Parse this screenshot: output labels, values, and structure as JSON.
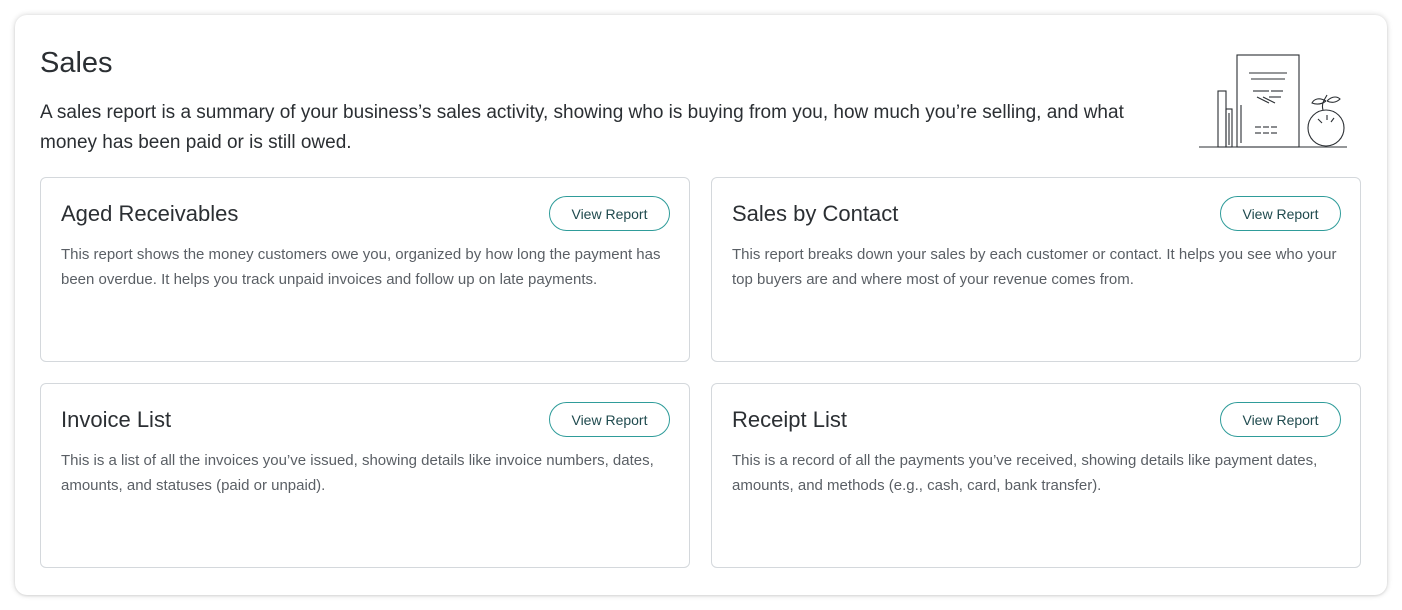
{
  "section": {
    "title": "Sales",
    "description": "A sales report is a summary of your business’s sales activity, showing who is buying from you, how much you’re selling, and what money has been paid or is still owed.",
    "illustration_icon": "sales-report-illustration"
  },
  "cards": [
    {
      "title": "Aged Receivables",
      "description": "This report shows the money customers owe you, organized by how long the payment has been overdue. It helps you track unpaid invoices and follow up on late payments.",
      "button_label": "View Report"
    },
    {
      "title": "Sales by Contact",
      "description": "This report breaks down your sales by each customer or contact. It helps you see who your top buyers are and where most of your revenue comes from.",
      "button_label": "View Report"
    },
    {
      "title": "Invoice List",
      "description": "This is a list of all the invoices you’ve issued, showing details like invoice numbers, dates, amounts, and statuses (paid or unpaid).",
      "button_label": "View Report"
    },
    {
      "title": "Receipt List",
      "description": "This is a record of all the payments you’ve received, showing details like payment dates, amounts, and methods (e.g., cash, card, bank transfer).",
      "button_label": "View Report"
    }
  ],
  "colors": {
    "accent": "#2f9c9a",
    "button_text": "#1f4a4e",
    "card_border": "#d4d8dc",
    "heading": "#2b2f33",
    "body_text": "#5a5f65"
  }
}
